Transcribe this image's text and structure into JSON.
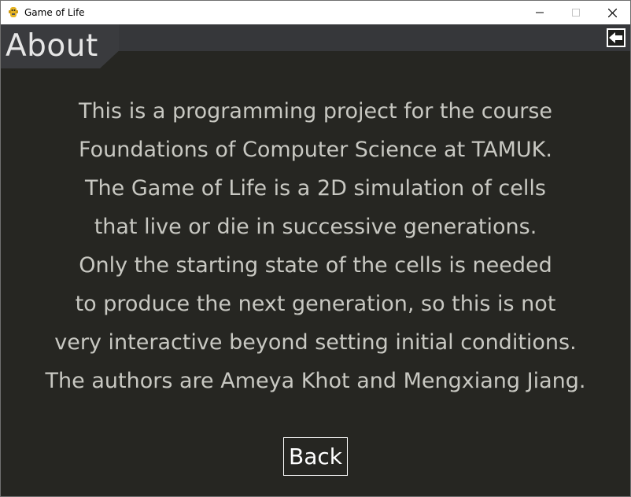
{
  "window": {
    "title": "Game of Life",
    "controls": {
      "minimize": "minimize-icon",
      "maximize": "maximize-icon",
      "close": "close-icon"
    }
  },
  "header": {
    "title": "About",
    "back_icon": "arrow-left-icon"
  },
  "about": {
    "lines": [
      "This is a programming project for the course",
      "Foundations of Computer Science at TAMUK.",
      "The Game of Life is a 2D simulation of cells",
      "that live or die in successive generations.",
      "Only the starting state of the cells is needed",
      "to produce the next generation, so this is not",
      "very interactive beyond setting initial conditions.",
      "The authors are Ameya Khot and Mengxiang Jiang."
    ]
  },
  "footer": {
    "back_label": "Back"
  },
  "colors": {
    "background": "#262622",
    "header_band": "#36373a",
    "text": "#c8c8c2",
    "title_text": "#e6e6e6",
    "button_border": "#ffffff"
  }
}
